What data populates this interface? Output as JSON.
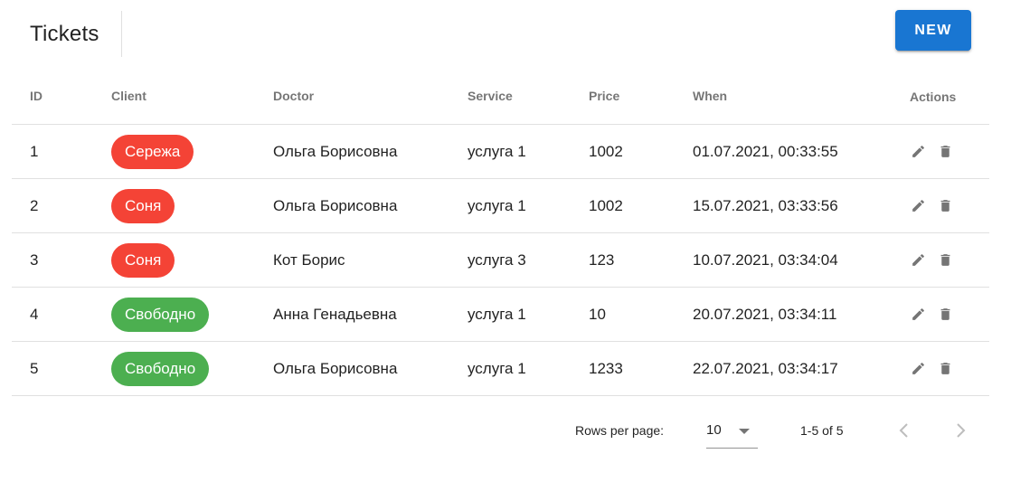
{
  "header": {
    "title": "Tickets",
    "new_button_label": "NEW",
    "accent_color": "#1976d2"
  },
  "table": {
    "columns": [
      "ID",
      "Client",
      "Doctor",
      "Service",
      "Price",
      "When",
      "Actions"
    ],
    "rows": [
      {
        "id": "1",
        "client": "Сережа",
        "client_status": "red",
        "doctor": "Ольга Борисовна",
        "service": "услуга 1",
        "price": "1002",
        "when": "01.07.2021, 00:33:55"
      },
      {
        "id": "2",
        "client": "Соня",
        "client_status": "red",
        "doctor": "Ольга Борисовна",
        "service": "услуга 1",
        "price": "1002",
        "when": "15.07.2021, 03:33:56"
      },
      {
        "id": "3",
        "client": "Соня",
        "client_status": "red",
        "doctor": "Кот Борис",
        "service": "услуга 3",
        "price": "123",
        "when": "10.07.2021, 03:34:04"
      },
      {
        "id": "4",
        "client": "Свободно",
        "client_status": "green",
        "doctor": "Анна Генадьевна",
        "service": "услуга 1",
        "price": "10",
        "when": "20.07.2021, 03:34:11"
      },
      {
        "id": "5",
        "client": "Свободно",
        "client_status": "green",
        "doctor": "Ольга Борисовна",
        "service": "услуга 1",
        "price": "1233",
        "when": "22.07.2021, 03:34:17"
      }
    ],
    "actions": {
      "edit_icon": "pencil-icon",
      "delete_icon": "trash-icon"
    },
    "chip_colors": {
      "red": "#f44336",
      "green": "#4caf50"
    }
  },
  "pagination": {
    "rows_per_page_label": "Rows per page:",
    "rows_per_page_value": "10",
    "range_text": "1-5 of 5",
    "prev_icon": "chevron-left-icon",
    "next_icon": "chevron-right-icon"
  }
}
